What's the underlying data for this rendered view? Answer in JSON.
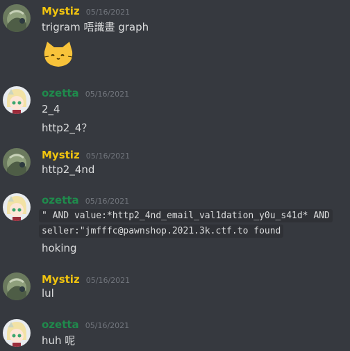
{
  "messages": [
    {
      "author": "Mystiz",
      "timestamp": "05/16/2021",
      "lines": [
        "trigram 唔識畫 graph"
      ],
      "emoji": "cat-face-emoji"
    },
    {
      "author": "ozetta",
      "timestamp": "05/16/2021",
      "lines": [
        "2_4",
        "http2_4？"
      ]
    },
    {
      "author": "Mystiz",
      "timestamp": "05/16/2021",
      "lines": [
        "http2_4nd"
      ]
    },
    {
      "author": "ozetta",
      "timestamp": "05/16/2021",
      "code": [
        "\" AND value:*http2_4nd_email_val1dation_y0u_s41d* AND",
        "seller:\"jmfffc@pawnshop.2021.3k.ctf.to found"
      ],
      "lines": [
        "hoking"
      ]
    },
    {
      "author": "Mystiz",
      "timestamp": "05/16/2021",
      "lines": [
        "lul"
      ]
    },
    {
      "author": "ozetta",
      "timestamp": "05/16/2021",
      "lines": [
        "huh 呢"
      ]
    }
  ],
  "colors": {
    "background": "#36393f",
    "author_mystiz": "#f1c40f",
    "author_ozetta": "#1f8b4c",
    "text": "#dcddde",
    "timestamp": "#72767d",
    "code_bg": "#2f3136"
  }
}
